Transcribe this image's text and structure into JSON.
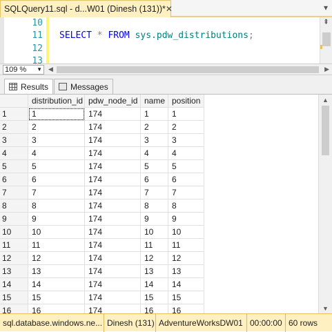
{
  "tab": {
    "title": "SQLQuery11.sql - d...W01 (Dinesh (131))*",
    "close": "✕",
    "pin": "▾"
  },
  "editor": {
    "line_numbers": [
      "10",
      "11",
      "12",
      "13"
    ],
    "line11": {
      "kw1": "SELECT",
      "star": "*",
      "kw2": "FROM",
      "object": "sys.pdw_distributions",
      "end": ";"
    }
  },
  "zoom": {
    "value": "109 %"
  },
  "results_tabs": {
    "results": "Results",
    "messages": "Messages"
  },
  "grid": {
    "columns": [
      "distribution_id",
      "pdw_node_id",
      "name",
      "position"
    ],
    "rows": [
      [
        "1",
        "1",
        "174",
        "1",
        "1"
      ],
      [
        "2",
        "2",
        "174",
        "2",
        "2"
      ],
      [
        "3",
        "3",
        "174",
        "3",
        "3"
      ],
      [
        "4",
        "4",
        "174",
        "4",
        "4"
      ],
      [
        "5",
        "5",
        "174",
        "5",
        "5"
      ],
      [
        "6",
        "6",
        "174",
        "6",
        "6"
      ],
      [
        "7",
        "7",
        "174",
        "7",
        "7"
      ],
      [
        "8",
        "8",
        "174",
        "8",
        "8"
      ],
      [
        "9",
        "9",
        "174",
        "9",
        "9"
      ],
      [
        "10",
        "10",
        "174",
        "10",
        "10"
      ],
      [
        "11",
        "11",
        "174",
        "11",
        "11"
      ],
      [
        "12",
        "12",
        "174",
        "12",
        "12"
      ],
      [
        "13",
        "13",
        "174",
        "13",
        "13"
      ],
      [
        "14",
        "14",
        "174",
        "14",
        "14"
      ],
      [
        "15",
        "15",
        "174",
        "15",
        "15"
      ],
      [
        "16",
        "16",
        "174",
        "16",
        "16"
      ]
    ]
  },
  "status": {
    "server": "sql.database.windows.ne...",
    "user": "Dinesh (131)",
    "database": "AdventureWorksDW01",
    "elapsed": "00:00:00",
    "rows": "60 rows"
  },
  "colors": {
    "tab_active": "#fff0c2",
    "status_bar": "#fff0c2",
    "keyword": "#0000ff",
    "line_number": "#2b91af",
    "identifier": "#008080"
  }
}
